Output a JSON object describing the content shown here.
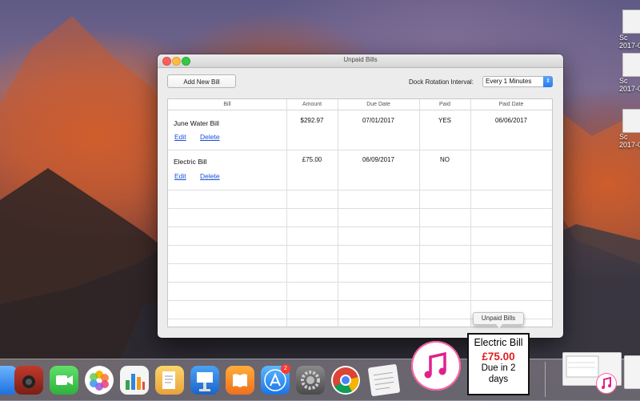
{
  "window": {
    "title": "Unpaid Bills",
    "add_button": "Add New Bill",
    "rotation_label": "Dock Rotation Interval:",
    "rotation_value": "Every 1 Minutes"
  },
  "table": {
    "columns": [
      "Bill",
      "Amount",
      "Due Date",
      "Paid",
      "Paid Date"
    ],
    "rows": [
      {
        "bill": "June Water Bill",
        "amount": "$292.97",
        "due": "07/01/2017",
        "paid": "YES",
        "paid_date": "06/06/2017",
        "edit": "Edit",
        "delete": "Delete"
      },
      {
        "bill": "Electric Bill",
        "amount": "£75.00",
        "due": "06/09/2017",
        "paid": "NO",
        "paid_date": "",
        "edit": "Edit",
        "delete": "Delete"
      }
    ]
  },
  "dock": {
    "tooltip": "Unpaid Bills",
    "app_store_badge": "2",
    "tile": {
      "title": "Electric Bill",
      "amount": "£75.00",
      "due": "Due in 2 days"
    }
  },
  "desktop": {
    "files": [
      {
        "label1": "Sc",
        "label2": "2017-0"
      },
      {
        "label1": "Sc",
        "label2": "2017-0"
      },
      {
        "label1": "Sc",
        "label2": "2017-0"
      }
    ]
  },
  "colors": {
    "accent": "#2a7af0",
    "link": "#1a4fd8",
    "tile_amount": "#e02020"
  }
}
